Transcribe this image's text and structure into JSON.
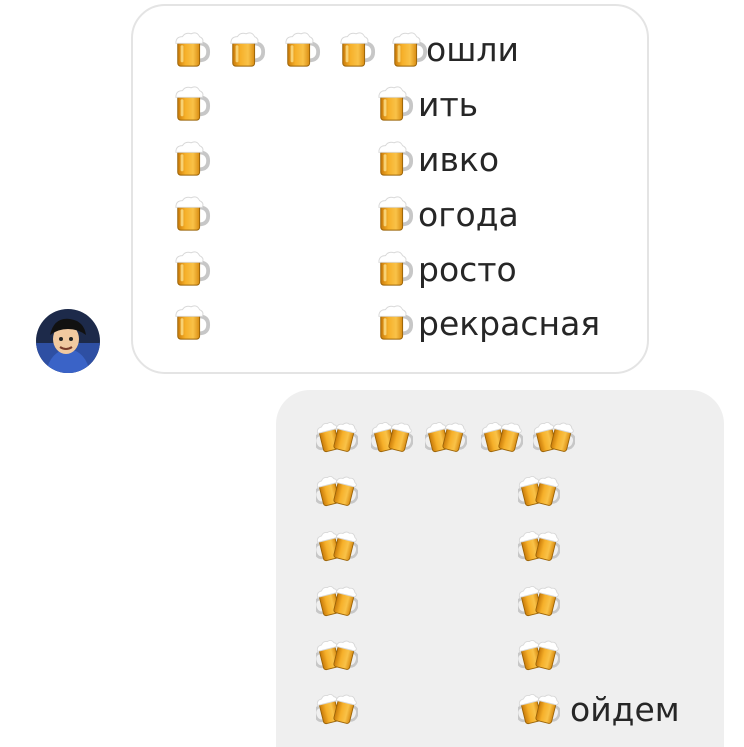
{
  "conversation": {
    "received": {
      "emoji_icon": "beer-mug-icon",
      "words": [
        "ошли",
        "ить",
        "ивко",
        "огода",
        "росто",
        "рекрасная"
      ]
    },
    "sent": {
      "emoji_icon": "clinking-beer-mugs-icon",
      "words": [
        "ойдем"
      ]
    }
  },
  "colors": {
    "received_bubble_border": "#e4e4e4",
    "sent_bubble_background": "#efefef",
    "text": "#262626",
    "beer": "#f2a51c",
    "foam": "#ffffff"
  }
}
